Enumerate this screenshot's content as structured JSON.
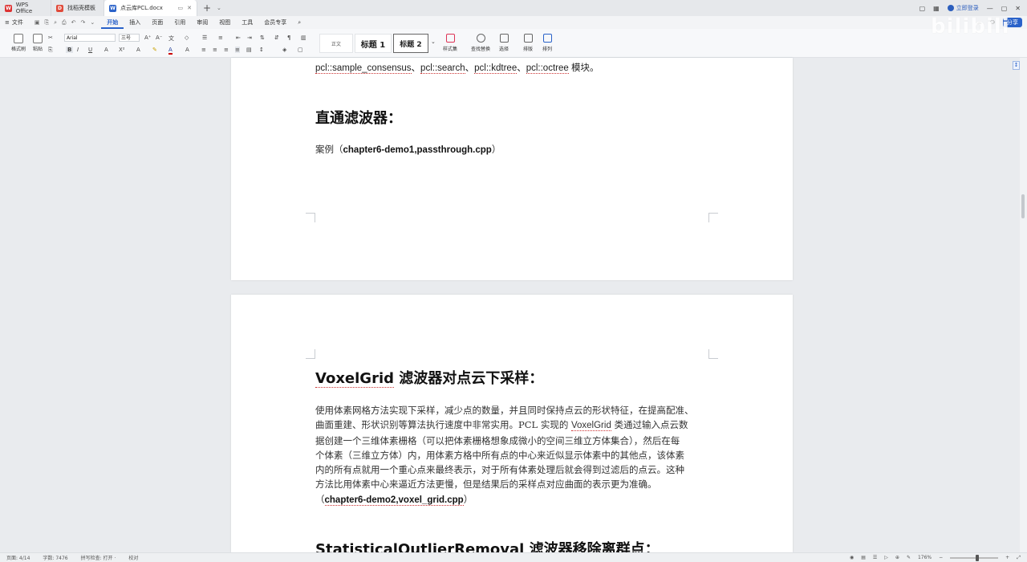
{
  "tabs": {
    "wps_office": "WPS Office",
    "templates": "找稻壳模板",
    "document": "点云库PCL.docx",
    "login": "立即登录"
  },
  "menu": {
    "file": "文件",
    "items": [
      "开始",
      "插入",
      "页面",
      "引用",
      "审阅",
      "视图",
      "工具",
      "会员专享"
    ],
    "share": "分享"
  },
  "ribbon": {
    "format_painter": "格式刷",
    "paste": "粘贴",
    "font": "Arial",
    "size": "三号",
    "style_body": "正文",
    "style_h1": "标题 1",
    "style_h2": "标题 2",
    "styles": "样式集",
    "find_replace": "查找替换",
    "select": "选择",
    "layout": "排版",
    "arrange": "排列"
  },
  "document": {
    "page1_line1_parts": [
      "pcl::sample_consensus",
      "、",
      "pcl::search",
      "、",
      "pcl::kdtree",
      "、",
      "pcl::octree",
      " 模块。"
    ],
    "heading_passthrough": "直通滤波器：",
    "example_prefix": "案例（",
    "example_file": "chapter6-demo1,passthrough.cpp",
    "example_suffix": "）",
    "heading_voxel_a": "VoxelGrid",
    "heading_voxel_b": " 滤波器对点云下采样：",
    "para_voxel_1": "使用体素网格方法实现下采样，减少点的数量，并且同时保持点云的形状特征，在提高配准、",
    "para_voxel_2a": "曲面重建、形状识别等算法执行速度中非常实用。PCL 实现的 ",
    "para_voxel_2b": "VoxelGrid",
    "para_voxel_2c": " 类通过输入点云数",
    "para_voxel_3": "据创建一个三维体素栅格（可以把体素栅格想象成微小的空间三维立方体集合），然后在每",
    "para_voxel_4": "个体素（三维立方体）内，用体素方格中所有点的中心来近似显示体素中的其他点，该体素",
    "para_voxel_5": "内的所有点就用一个重心点来最终表示，对于所有体素处理后就会得到过滤后的点云。这种",
    "para_voxel_6": "方法比用体素中心来逼近方法更慢，但是结果后的采样点对应曲面的表示更为准确。",
    "example2_prefix": "（",
    "example2_file": "chapter6-demo2,voxel_grid.cpp",
    "example2_suffix": "）",
    "heading_sor_a": "StatisticalOutlierRemoval",
    "heading_sor_b": " 滤波器移除离群点："
  },
  "status": {
    "page": "页面: 4/14",
    "words": "字数: 7476",
    "spell": "拼写检查: 打开 ·",
    "proof": "校对",
    "zoom": "176%"
  },
  "colors": {
    "accent": "#2a62c9",
    "page_bg": "#ffffff",
    "canvas_bg": "#e9ebee"
  }
}
